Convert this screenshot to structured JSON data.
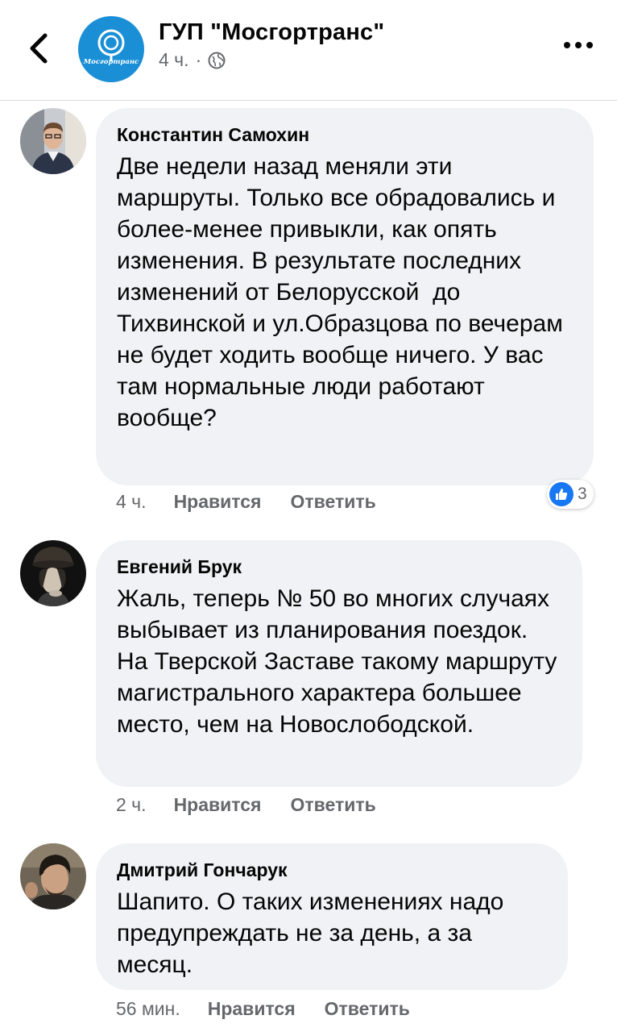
{
  "header": {
    "page_name": "ГУП \"Мосгортранс\"",
    "time": "4 ч.",
    "separator": "·",
    "logo_text": "Мосгортранс",
    "brand_color": "#1a8fd6"
  },
  "comments": [
    {
      "author": "Константин Самохин",
      "text": "Две недели назад меняли эти маршруты. Только все обрадовались и более-менее привыкли, как опять изменения. В результате последних изменений от Белорусской  до Тихвинской и ул.Образцова по вечерам не будет ходить вообще ничего. У вас там нормальные люди работают вообще?",
      "time": "4 ч.",
      "like_label": "Нравится",
      "reply_label": "Ответить",
      "reaction_count": "3"
    },
    {
      "author": "Евгений Брук",
      "text": "Жаль, теперь № 50 во многих случаях выбывает из планирования поездок. На Тверской Заставе такому маршруту магистрального характера большее место, чем на Новослободской.",
      "time": "2 ч.",
      "like_label": "Нравится",
      "reply_label": "Ответить"
    },
    {
      "author": "Дмитрий Гончарук",
      "text": "Шапито. О таких изменениях надо предупреждать не за день, а за месяц.",
      "time": "56 мин.",
      "like_label": "Нравится",
      "reply_label": "Ответить"
    }
  ],
  "icons": {
    "back": "chevron-left-icon",
    "more": "more-horizontal-icon",
    "audience": "globe-icon",
    "reaction": "thumbs-up-icon"
  }
}
